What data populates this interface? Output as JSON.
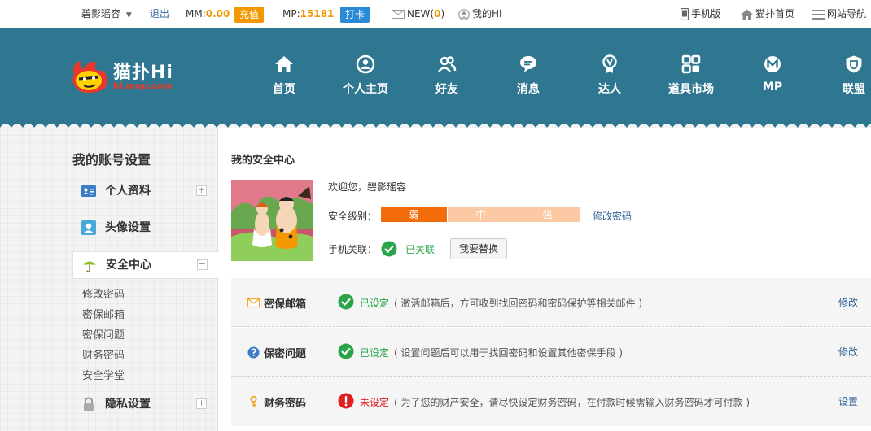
{
  "topbar": {
    "username": "碧影瑶容",
    "logout": "退出",
    "mm_label": "MM:",
    "mm_value": "0.00",
    "recharge": "充值",
    "mp_label": "MP:",
    "mp_value": "15181",
    "checkin": "打卡",
    "new_label": "NEW(",
    "new_count": "0",
    "new_close": ")",
    "my_hi": "我的Hi",
    "mobile": "手机版",
    "home": "猫扑首页",
    "site_nav": "网站导航"
  },
  "logo": {
    "title": "猫扑Hi",
    "domain": "hi.mop.com"
  },
  "nav": [
    "首页",
    "个人主页",
    "好友",
    "消息",
    "达人",
    "道具市场",
    "MP",
    "联盟"
  ],
  "sidebar": {
    "title": "我的账号设置",
    "items": [
      {
        "label": "个人资料",
        "icon": "id-card-icon"
      },
      {
        "label": "头像设置",
        "icon": "avatar-icon"
      },
      {
        "label": "安全中心",
        "icon": "umbrella-icon"
      },
      {
        "label": "隐私设置",
        "icon": "lock-icon"
      }
    ],
    "sub_items": [
      "修改密码",
      "密保邮箱",
      "密保问题",
      "财务密码",
      "安全学堂"
    ]
  },
  "main": {
    "title": "我的安全中心",
    "welcome_prefix": "欢迎您，",
    "welcome_name": "碧影瑶容",
    "level_label": "安全级别：",
    "levels": [
      "弱",
      "中",
      "强"
    ],
    "change_password": "修改密码",
    "phone_label": "手机关联：",
    "phone_status": "已关联",
    "swap_button": "我要替换",
    "rows": [
      {
        "name": "密保邮箱",
        "status": "已设定",
        "desc": "( 激活邮箱后，方可收到找回密码和密码保护等相关邮件 )",
        "action": "修改"
      },
      {
        "name": "保密问题",
        "status": "已设定",
        "desc": "( 设置问题后可以用于找回密码和设置其他密保手段 )",
        "action": "修改"
      },
      {
        "name": "财务密码",
        "status": "未设定",
        "desc": "( 为了您的财产安全，请尽快设定财务密码，在付款时候需输入财务密码才可付款 )",
        "action": "设置"
      }
    ]
  },
  "colors": {
    "header": "#2f7791",
    "accent_orange": "#f39800",
    "level_weak": "#f36c0a",
    "level_inactive": "#fcc9a5",
    "ok_green": "#2aa54a",
    "warn_red": "#e02020",
    "link": "#336699"
  }
}
